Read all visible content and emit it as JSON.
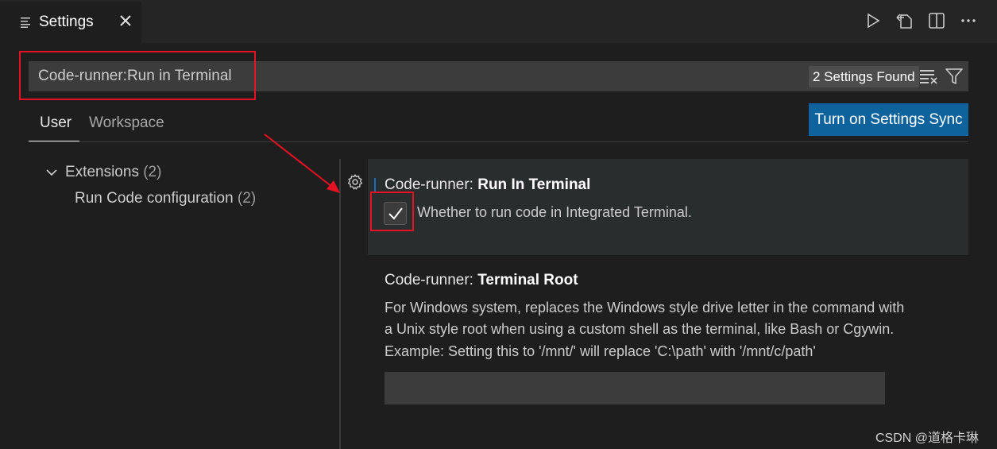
{
  "tab": {
    "title": "Settings"
  },
  "search": {
    "value": "Code-runner:Run in Terminal",
    "found": "2 Settings Found"
  },
  "scopes": {
    "user": "User",
    "workspace": "Workspace"
  },
  "sync_button": "Turn on Settings Sync",
  "toc": {
    "extensions": "Extensions",
    "extensions_count": "(2)",
    "run_code": "Run Code configuration",
    "run_code_count": "(2)"
  },
  "settings": [
    {
      "category": "Code-runner: ",
      "key": "Run In Terminal",
      "checked": true,
      "description": "Whether to run code in Integrated Terminal."
    },
    {
      "category": "Code-runner: ",
      "key": "Terminal Root",
      "description_lines": [
        "For Windows system, replaces the Windows style drive letter in the command with",
        "a Unix style root when using a custom shell as the terminal, like Bash or Cgywin.",
        "Example: Setting this to '/mnt/' will replace 'C:\\path' with '/mnt/c/path'"
      ],
      "value": ""
    }
  ],
  "watermark": "CSDN @道格卡琳",
  "colors": {
    "accent": "#0e639c",
    "highlight": "#e81123"
  }
}
